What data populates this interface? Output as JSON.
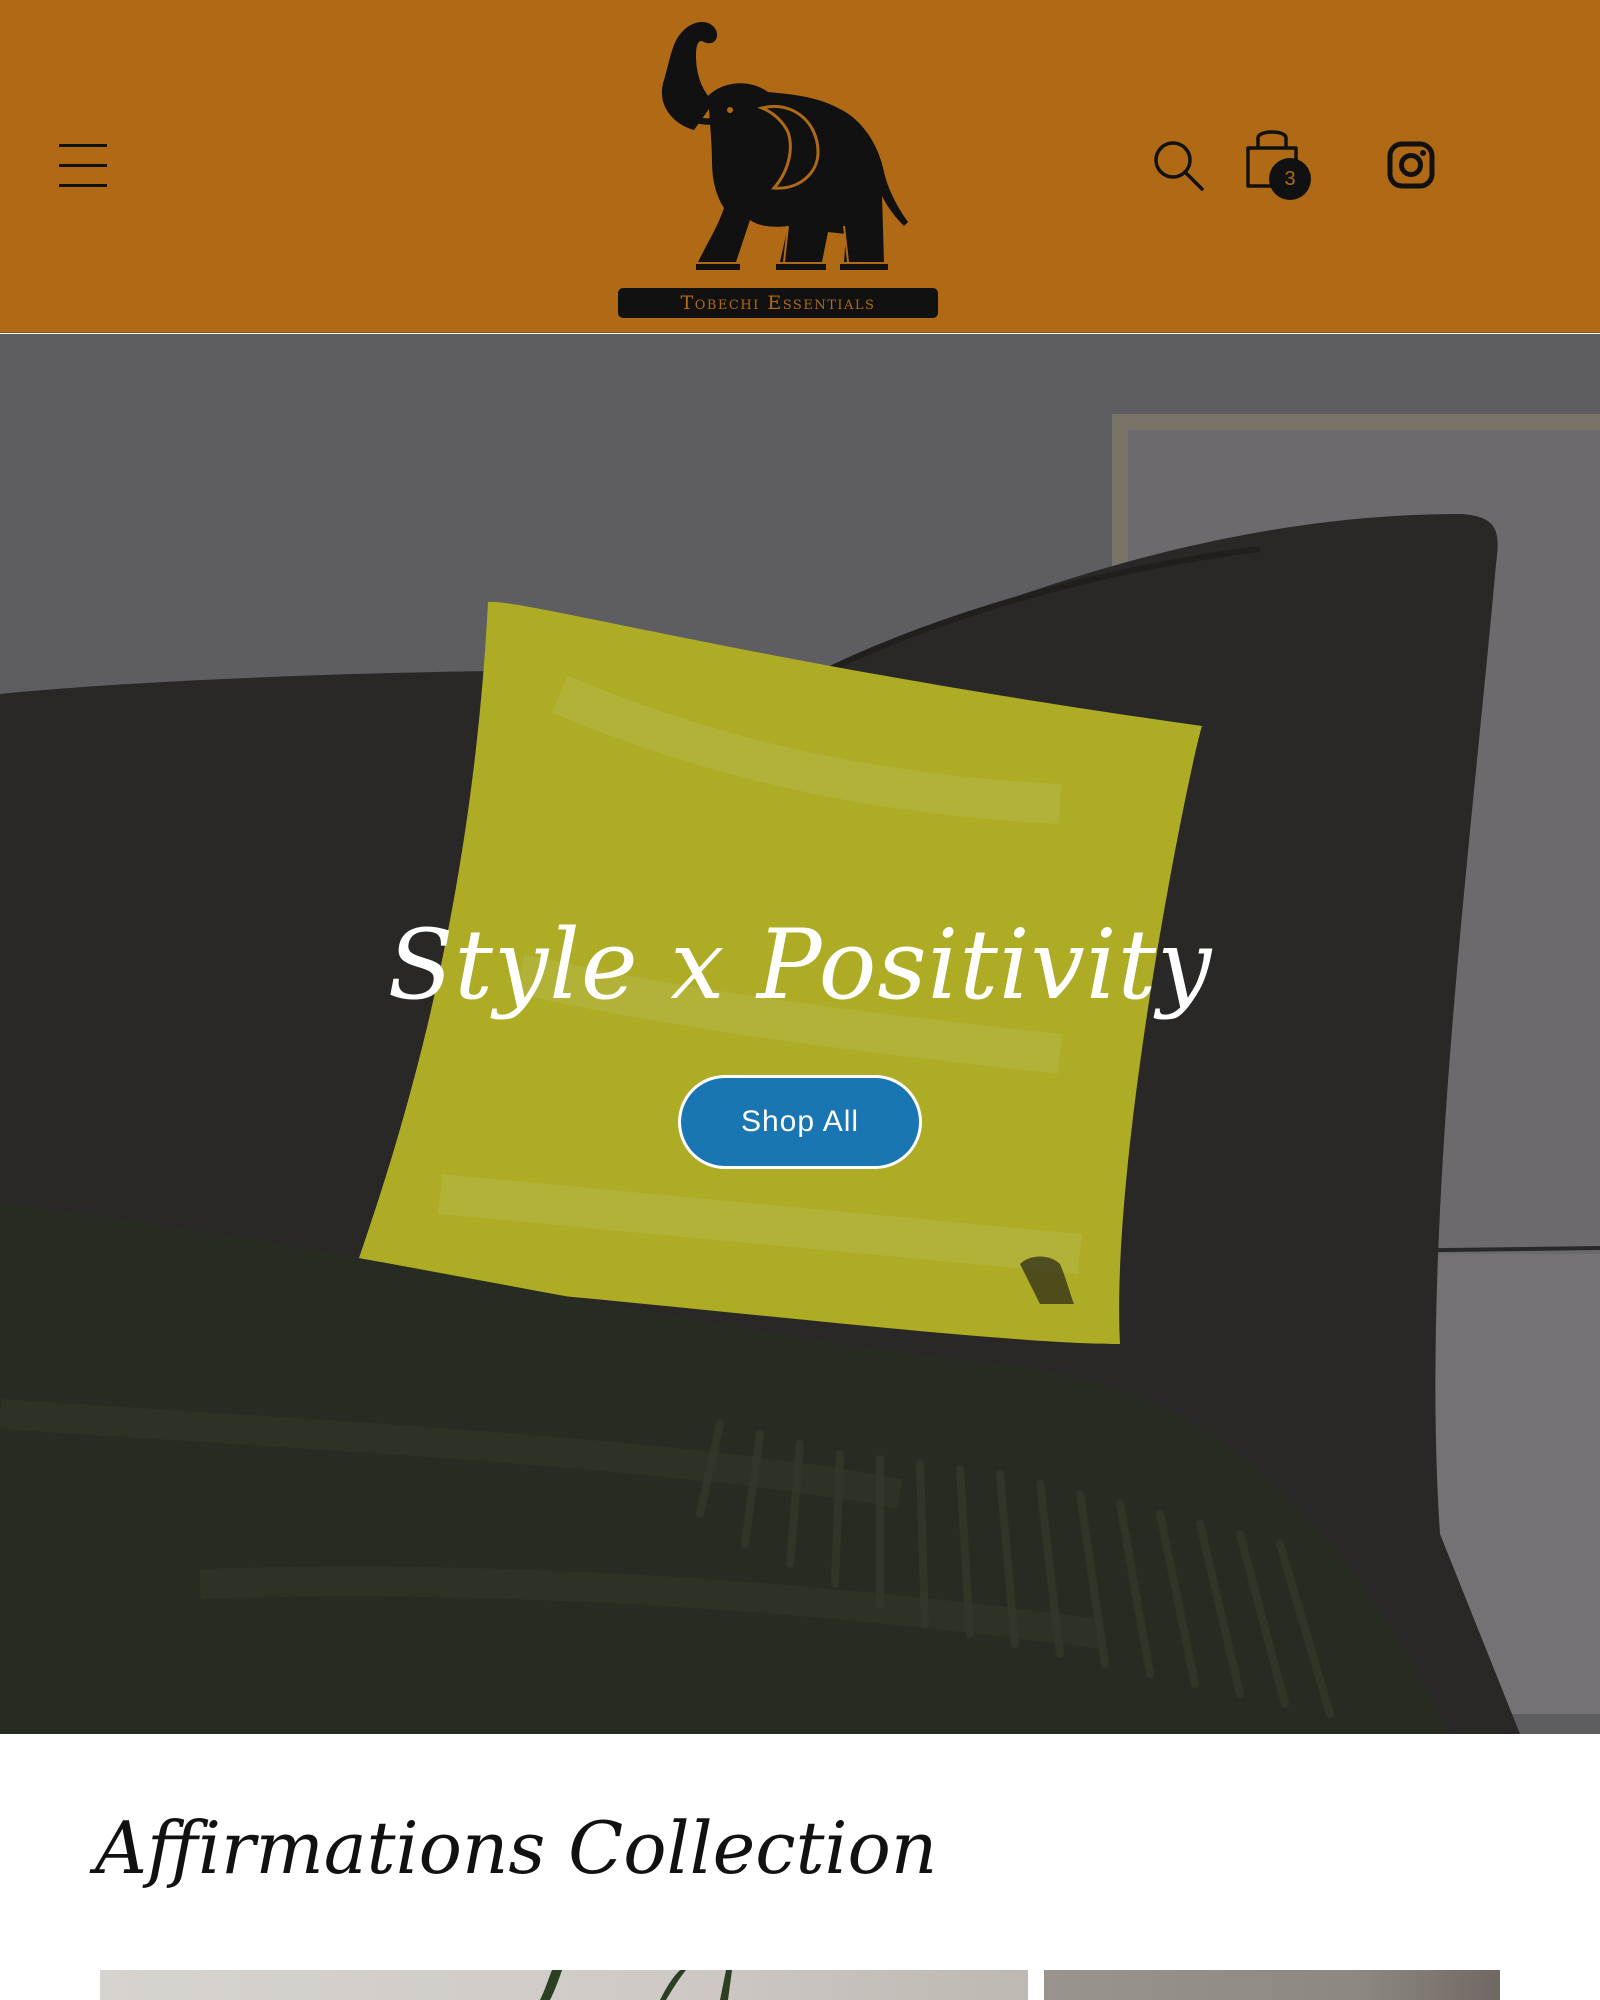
{
  "header": {
    "brand_text": "Tobechi Essentials",
    "cart_count": "3",
    "icons": {
      "menu": "hamburger-menu-icon",
      "search": "search-icon",
      "cart": "shopping-bag-icon",
      "social": "instagram-icon"
    },
    "colors": {
      "background": "#b06a16",
      "ink": "#111111"
    }
  },
  "hero": {
    "title": "Style x Positivity",
    "cta_label": "Shop All",
    "colors": {
      "cta": "#1a75b3",
      "pillow": "#c9c52a"
    }
  },
  "collection": {
    "title": "Affirmations Collection"
  }
}
